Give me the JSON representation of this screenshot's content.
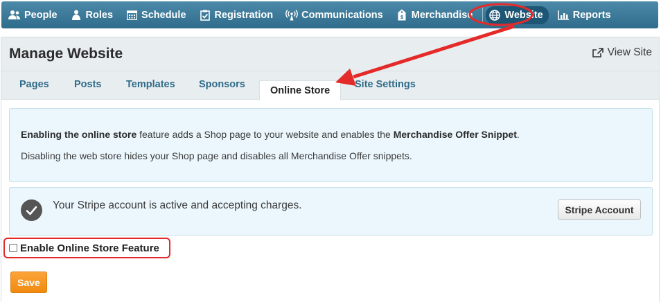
{
  "nav": {
    "items": [
      {
        "label": "People",
        "icon": "people-icon"
      },
      {
        "label": "Roles",
        "icon": "roles-icon"
      },
      {
        "label": "Schedule",
        "icon": "calendar-icon"
      },
      {
        "label": "Registration",
        "icon": "clipboard-check-icon"
      },
      {
        "label": "Communications",
        "icon": "broadcast-icon"
      },
      {
        "label": "Merchandise",
        "icon": "price-tag-icon"
      },
      {
        "label": "Website",
        "icon": "globe-icon",
        "active": true
      },
      {
        "label": "Reports",
        "icon": "bar-chart-icon"
      }
    ]
  },
  "header": {
    "title": "Manage Website",
    "view_site": "View Site"
  },
  "tabs": [
    {
      "label": "Pages"
    },
    {
      "label": "Posts"
    },
    {
      "label": "Templates"
    },
    {
      "label": "Sponsors"
    },
    {
      "label": "Online Store",
      "active": true
    },
    {
      "label": "Site Settings"
    }
  ],
  "info": {
    "line1_bold1": "Enabling the online store",
    "line1_text1": " feature adds a Shop page to your website and enables the ",
    "line1_bold2": "Merchandise Offer Snippet",
    "line1_text2": ".",
    "line2": "Disabling the web store hides your Shop page and disables all Merchandise Offer snippets."
  },
  "stripe": {
    "status": "Your Stripe account is active and accepting charges.",
    "button": "Stripe Account"
  },
  "enable": {
    "label": "Enable Online Store Feature",
    "checked": false
  },
  "save": "Save",
  "colors": {
    "nav_bg": "#2f6b8a",
    "tab_text": "#2f6b8a",
    "info_bg": "#ebf7fd",
    "save_bg": "#f49416",
    "annotation": "#e52a2a"
  }
}
